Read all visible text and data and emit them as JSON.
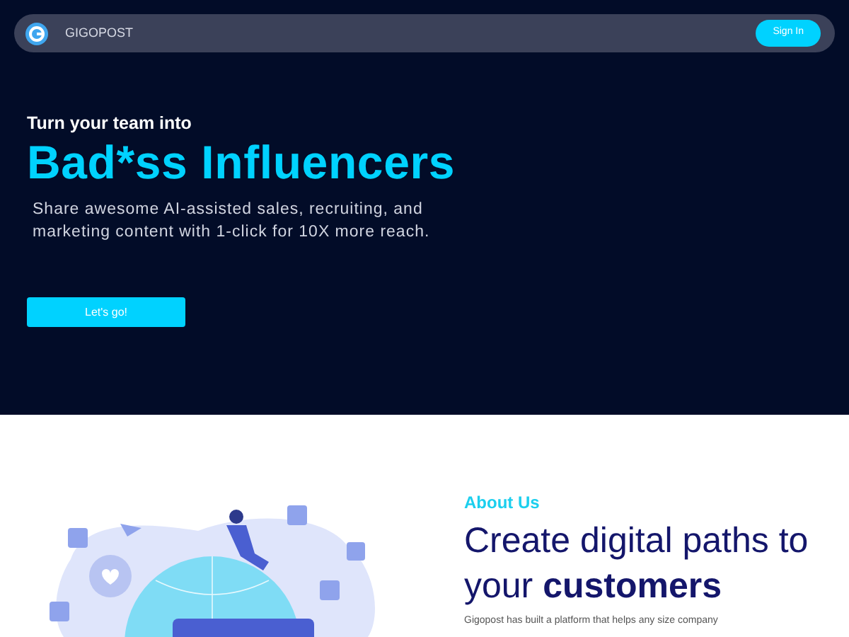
{
  "navbar": {
    "brand": "GIGOPOST",
    "sign_in": "Sign In"
  },
  "hero": {
    "kicker": "Turn your team into",
    "title": "Bad*ss Influencers",
    "subtitle": "Share awesome AI-assisted sales, recruiting, and marketing content with 1-click for 10X more reach.",
    "cta": "Let's go!"
  },
  "about": {
    "label": "About Us",
    "heading": "Create digital paths to your **customers**",
    "body": "Gigopost has built a platform that helps any size company"
  }
}
